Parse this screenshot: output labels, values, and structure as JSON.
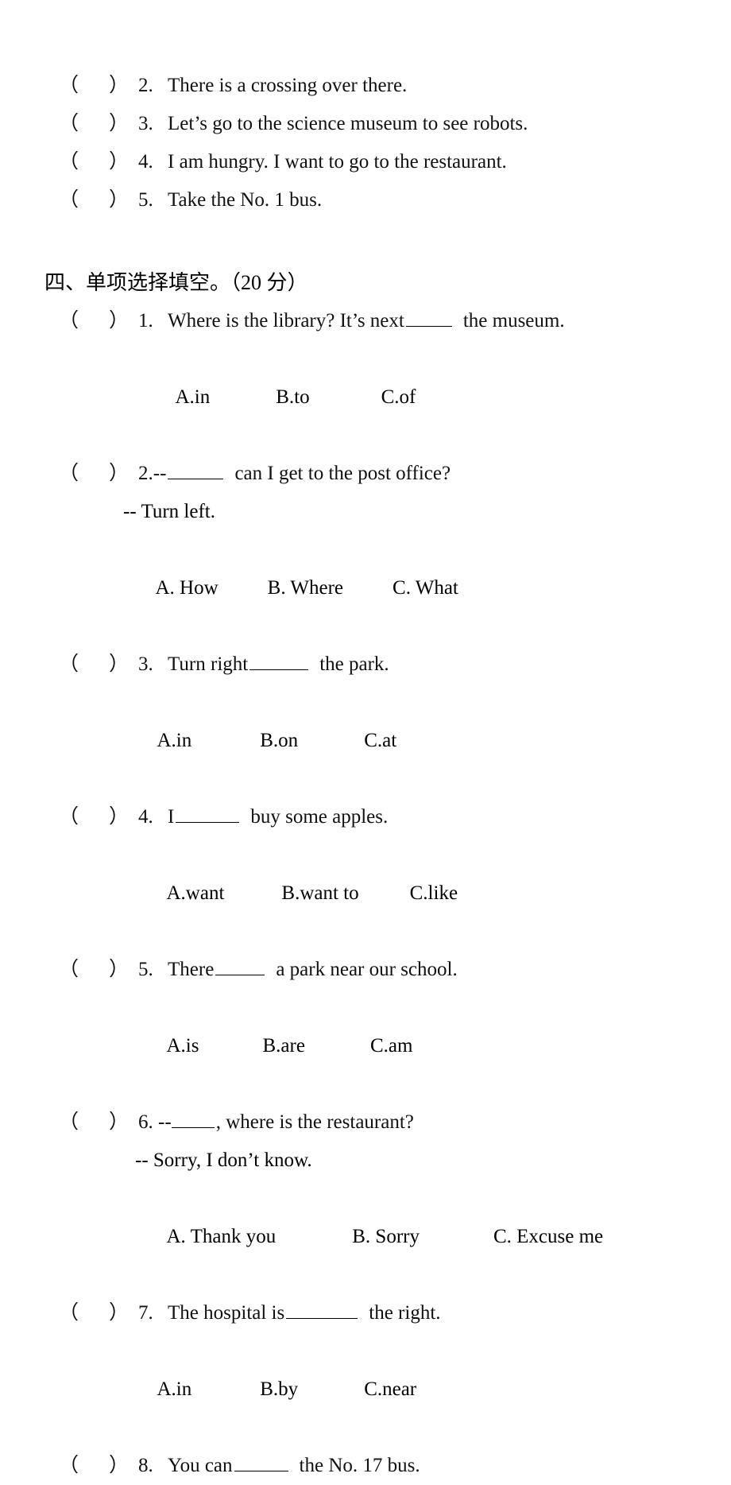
{
  "document": {
    "type": "english-exam-worksheet",
    "page_background": "#ffffff",
    "text_color": "#000000"
  },
  "judge_section": {
    "items": [
      {
        "paren_open": "（",
        "paren_close": "）",
        "number": "2.",
        "text": "There is a crossing over there."
      },
      {
        "paren_open": "（",
        "paren_close": "）",
        "number": "3.",
        "text": "Let’s go to the science museum to see robots."
      },
      {
        "paren_open": "（",
        "paren_close": "）",
        "number": "4.",
        "text": "I am hungry. I want to go to the restaurant."
      },
      {
        "paren_open": "（",
        "paren_close": "）",
        "number": "5.",
        "text": "Take the No. 1 bus."
      }
    ]
  },
  "choice_section": {
    "heading": "四、单项选择填空。（20 分）",
    "questions": [
      {
        "paren_open": "（",
        "paren_close": "）",
        "number": "1.",
        "stem_before": "Where is the library? It’s next",
        "stem_after": "the museum.",
        "options": {
          "a": "A.in",
          "b": "B.to",
          "c": "C.of"
        }
      },
      {
        "paren_open": "（",
        "paren_close": "）",
        "number": "2.--",
        "stem_before": "",
        "stem_after": "can I get to the post office?",
        "answer_line": "-- Turn left.",
        "options": {
          "a": "A. How",
          "b": "B. Where",
          "c": "C. What"
        }
      },
      {
        "paren_open": "（",
        "paren_close": "）",
        "number": "3.",
        "stem_before": "Turn right",
        "stem_after": "the park.",
        "options": {
          "a": "A.in",
          "b": "B.on",
          "c": "C.at"
        }
      },
      {
        "paren_open": "（",
        "paren_close": "）",
        "number": "4.",
        "stem_before": "I",
        "stem_after": "buy some apples.",
        "options": {
          "a": "A.want",
          "b": "B.want to",
          "c": "C.like"
        }
      },
      {
        "paren_open": "（",
        "paren_close": "）",
        "number": "5.",
        "stem_before": "There",
        "stem_after": "a park near our school.",
        "options": {
          "a": "A.is",
          "b": "B.are",
          "c": "C.am"
        }
      },
      {
        "paren_open": "（",
        "paren_close": "）",
        "number": "6. --",
        "stem_before": "",
        "stem_after": ", where is the restaurant?",
        "answer_line": "-- Sorry, I don’t know.",
        "options": {
          "a": "A. Thank you",
          "b": "B. Sorry",
          "c": "C. Excuse me"
        }
      },
      {
        "paren_open": "（",
        "paren_close": "）",
        "number": "7.",
        "stem_before": "The hospital is",
        "stem_after": "the right.",
        "options": {
          "a": "A.in",
          "b": "B.by",
          "c": "C.near"
        }
      },
      {
        "paren_open": "（",
        "paren_close": "）",
        "number": "8.",
        "stem_before": "You can",
        "stem_after": "the No. 17 bus.",
        "options": null
      }
    ]
  }
}
